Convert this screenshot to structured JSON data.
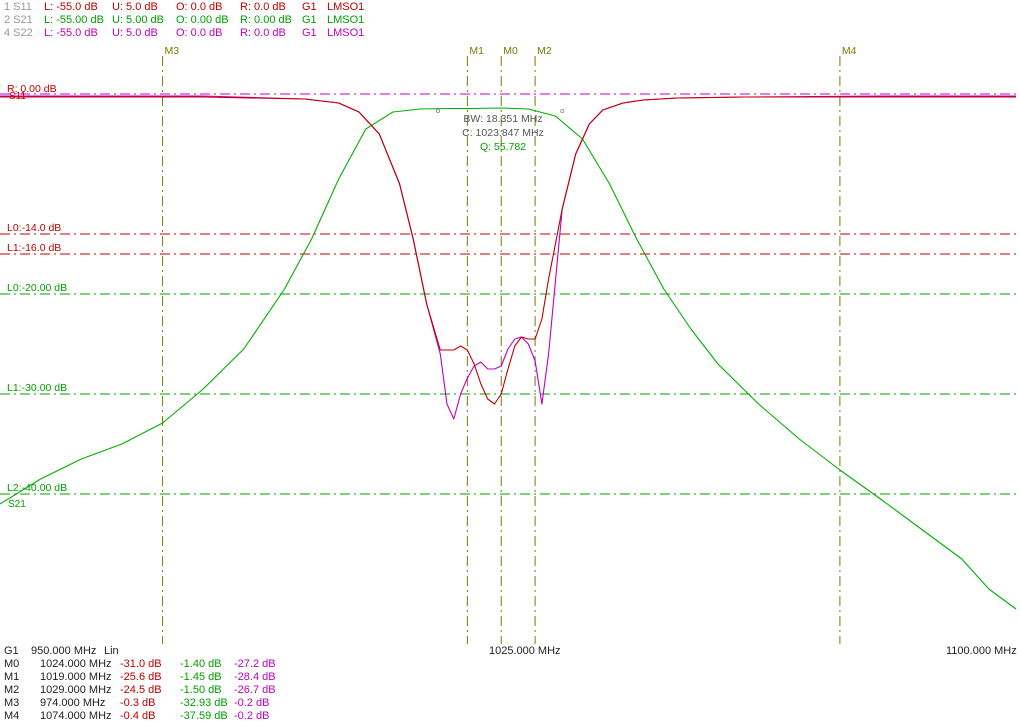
{
  "header": {
    "traces": [
      {
        "id": "1 S11",
        "lower": "L: -55.0 dB",
        "upper": "U:  5.0 dB",
        "offset": "O:  0.0 dB",
        "ref": "R:  0.0 dB",
        "group": "G1",
        "mode": "LMSO1",
        "color": "#c00000"
      },
      {
        "id": "2 S21",
        "lower": "L: -55.00 dB",
        "upper": "U:  5.00 dB",
        "offset": "O:  0.00 dB",
        "ref": "R:  0.00 dB",
        "group": "G1",
        "mode": "LMSO1",
        "color": "#00a000"
      },
      {
        "id": "4 S22",
        "lower": "L: -55.0 dB",
        "upper": "U:  5.0 dB",
        "offset": "O:  0.0 dB",
        "ref": "R:  0.0 dB",
        "group": "G1",
        "mode": "LMSO1",
        "color": "#c000c0"
      }
    ]
  },
  "footer": {
    "group": "G1",
    "start": "950.000 MHz",
    "scale": "Lin",
    "center": "1025.000 MHz",
    "stop": "1100.000 MHz"
  },
  "markers": [
    {
      "name": "M0",
      "freq": "1024.000 MHz",
      "s11": "-31.0 dB",
      "s21": "-1.40 dB",
      "s22": "-27.2 dB"
    },
    {
      "name": "M1",
      "freq": "1019.000 MHz",
      "s11": "-25.6 dB",
      "s21": "-1.45 dB",
      "s22": "-28.4 dB"
    },
    {
      "name": "M2",
      "freq": "1029.000 MHz",
      "s11": "-24.5 dB",
      "s21": "-1.50 dB",
      "s22": "-26.7 dB"
    },
    {
      "name": "M3",
      "freq": "974.000 MHz",
      "s11": "-0.3 dB",
      "s21": "-32.93 dB",
      "s22": "-0.2 dB"
    },
    {
      "name": "M4",
      "freq": "1074.000 MHz",
      "s11": "-0.4 dB",
      "s21": "-37.59 dB",
      "s22": "-0.2 dB"
    }
  ],
  "plot": {
    "ref_label": "R: 0.00 dB",
    "ref_value_db": 0,
    "trace_tags": [
      "S11",
      "S21"
    ],
    "limit_lines": [
      {
        "label": "L0:-14.0 dB",
        "value_db": -14,
        "color": "#c00000"
      },
      {
        "label": "L1:-16.0 dB",
        "value_db": -16,
        "color": "#c00000"
      },
      {
        "label": "L0:-20.00 dB",
        "value_db": -20,
        "color": "#00a000"
      },
      {
        "label": "L1:-30.00 dB",
        "value_db": -30,
        "color": "#00a000"
      },
      {
        "label": "L2:-40.00 dB",
        "value_db": -40,
        "color": "#00a000"
      }
    ],
    "marker_lines": [
      {
        "label": "M3",
        "freq_mhz": 974
      },
      {
        "label": "M1",
        "freq_mhz": 1019
      },
      {
        "label": "M0",
        "freq_mhz": 1024
      },
      {
        "label": "M2",
        "freq_mhz": 1029
      },
      {
        "label": "M4",
        "freq_mhz": 1074
      }
    ],
    "bw_annotation": {
      "bw": "BW:  18.351 MHz",
      "center": "C: 1023.847 MHz",
      "q": "Q:  55.782"
    }
  },
  "colors": {
    "s11": "#c00000",
    "s21": "#00b000",
    "s22": "#c000c0",
    "marker_line": "#7a7a00",
    "ref_line": "#c000c0"
  },
  "chart_data": {
    "type": "line",
    "title": "",
    "xlabel": "",
    "ylabel": "",
    "xlim": [
      950,
      1100
    ],
    "ylim": [
      -55,
      5
    ],
    "x_unit": "MHz",
    "y_unit": "dB",
    "series": [
      {
        "name": "S11",
        "x": [
          950,
          980,
          995,
          1000,
          1003,
          1006,
          1009,
          1011,
          1013,
          1015,
          1017,
          1018,
          1019,
          1020,
          1021,
          1022,
          1023,
          1024,
          1025,
          1026,
          1027,
          1028,
          1029,
          1030,
          1031,
          1033,
          1035,
          1037,
          1039,
          1042,
          1045,
          1050,
          1060,
          1080,
          1100
        ],
        "y": [
          -0.3,
          -0.3,
          -0.5,
          -0.9,
          -1.8,
          -4.0,
          -9.0,
          -14.5,
          -21.0,
          -25.6,
          -25.6,
          -25.2,
          -25.6,
          -27.0,
          -29.0,
          -30.5,
          -31.0,
          -30.0,
          -27.5,
          -25.2,
          -24.3,
          -24.5,
          -24.5,
          -22.5,
          -18.5,
          -11.5,
          -6.0,
          -3.0,
          -1.6,
          -0.9,
          -0.6,
          -0.4,
          -0.3,
          -0.3,
          -0.3
        ]
      },
      {
        "name": "S21",
        "x": [
          950,
          956,
          962,
          968,
          974,
          980,
          986,
          992,
          996,
          1000,
          1004,
          1008,
          1012,
          1016,
          1020,
          1024,
          1028,
          1032,
          1036,
          1040,
          1044,
          1048,
          1052,
          1056,
          1062,
          1068,
          1074,
          1080,
          1086,
          1092,
          1096,
          1100
        ],
        "y": [
          -41.0,
          -38.5,
          -36.5,
          -35.0,
          -32.9,
          -29.5,
          -25.5,
          -19.5,
          -14.5,
          -8.5,
          -3.5,
          -1.8,
          -1.5,
          -1.45,
          -1.45,
          -1.4,
          -1.5,
          -2.2,
          -4.5,
          -9.0,
          -14.5,
          -19.5,
          -23.5,
          -27.0,
          -31.0,
          -34.5,
          -37.6,
          -40.5,
          -43.5,
          -46.5,
          -49.5,
          -51.5
        ]
      },
      {
        "name": "S22",
        "x": [
          950,
          980,
          995,
          1000,
          1003,
          1006,
          1009,
          1011,
          1013,
          1015,
          1016,
          1017,
          1018,
          1019,
          1020,
          1021,
          1022,
          1023,
          1024,
          1025,
          1026,
          1027,
          1028,
          1029,
          1030,
          1031,
          1033,
          1035,
          1037,
          1039,
          1042,
          1045,
          1050,
          1060,
          1080,
          1100
        ],
        "y": [
          -0.2,
          -0.2,
          -0.5,
          -0.9,
          -1.8,
          -4.0,
          -9.0,
          -14.5,
          -21.0,
          -26.0,
          -31.0,
          -32.5,
          -30.0,
          -28.4,
          -27.2,
          -26.8,
          -27.5,
          -27.5,
          -27.2,
          -25.5,
          -24.5,
          -24.3,
          -25.0,
          -26.7,
          -31.0,
          -26.0,
          -11.5,
          -6.0,
          -3.0,
          -1.6,
          -0.9,
          -0.6,
          -0.4,
          -0.3,
          -0.2,
          -0.2
        ]
      }
    ]
  }
}
